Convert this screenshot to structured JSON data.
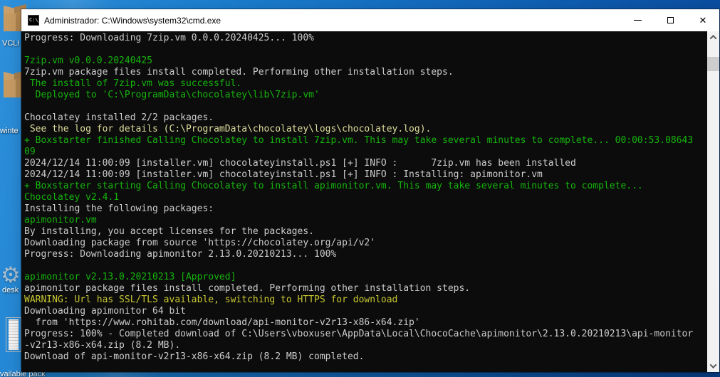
{
  "palette": {
    "consoleBg": "#0C0C0C",
    "white": "#CCCCCC",
    "green": "#15B50D",
    "yellow": "#C9C932",
    "paleYellow": "#DEDE9E",
    "titlebarBg": "#FFFFFF",
    "desktopBlue": "#1671C4"
  },
  "desktop": {
    "icons": [
      {
        "label": "VCLi",
        "type": "box"
      },
      {
        "label": "winte",
        "type": "box"
      },
      {
        "label": "desk",
        "type": "gear",
        "glyph": "⚙"
      },
      {
        "label": "vailable pack",
        "type": "note"
      }
    ]
  },
  "window": {
    "title": "Administrador: C:\\Windows\\system32\\cmd.exe",
    "icon_glyph": "C:\\_",
    "controls": {
      "close_glyph": "✕"
    }
  },
  "console": {
    "lines": [
      {
        "text": "Progress: Downloading 7zip.vm 0.0.0.20240425... 100%",
        "color": "white"
      },
      {
        "text": "",
        "color": "white"
      },
      {
        "text": "7zip.vm v0.0.0.20240425",
        "color": "green"
      },
      {
        "text": "7zip.vm package files install completed. Performing other installation steps.",
        "color": "white"
      },
      {
        "text": " The install of 7zip.vm was successful.",
        "color": "green"
      },
      {
        "text": "  Deployed to 'C:\\ProgramData\\chocolatey\\lib\\7zip.vm'",
        "color": "green"
      },
      {
        "text": "",
        "color": "white"
      },
      {
        "text": "Chocolatey installed 2/2 packages.",
        "color": "white"
      },
      {
        "text": " See the log for details (C:\\ProgramData\\chocolatey\\logs\\chocolatey.log).",
        "color": "paleyellow"
      },
      {
        "text": "+ Boxstarter finished Calling Chocolatey to install 7zip.vm. This may take several minutes to complete... 00:00:53.08643",
        "color": "green"
      },
      {
        "text": "09",
        "color": "green"
      },
      {
        "text": "2024/12/14 11:00:09 [installer.vm] chocolateyinstall.ps1 [+] INFO :      7zip.vm has been installed",
        "color": "white"
      },
      {
        "text": "2024/12/14 11:00:09 [installer.vm] chocolateyinstall.ps1 [+] INFO : Installing: apimonitor.vm",
        "color": "white"
      },
      {
        "text": "+ Boxstarter starting Calling Chocolatey to install apimonitor.vm. This may take several minutes to complete...",
        "color": "green"
      },
      {
        "text": "Chocolatey v2.4.1",
        "color": "green"
      },
      {
        "text": "Installing the following packages:",
        "color": "white"
      },
      {
        "text": "apimonitor.vm",
        "color": "green"
      },
      {
        "text": "By installing, you accept licenses for the packages.",
        "color": "white"
      },
      {
        "text": "Downloading package from source 'https://chocolatey.org/api/v2'",
        "color": "white"
      },
      {
        "text": "Progress: Downloading apimonitor 2.13.0.20210213... 100%",
        "color": "white"
      },
      {
        "text": "",
        "color": "white"
      },
      {
        "text": "apimonitor v2.13.0.20210213 [Approved]",
        "color": "green"
      },
      {
        "text": "apimonitor package files install completed. Performing other installation steps.",
        "color": "white"
      },
      {
        "text": "WARNING: Url has SSL/TLS available, switching to HTTPS for download",
        "color": "yellow"
      },
      {
        "text": "Downloading apimonitor 64 bit",
        "color": "white"
      },
      {
        "text": "  from 'https://www.rohitab.com/download/api-monitor-v2r13-x86-x64.zip'",
        "color": "white"
      },
      {
        "text": "Progress: 100% - Completed download of C:\\Users\\vboxuser\\AppData\\Local\\ChocoCache\\apimonitor\\2.13.0.20210213\\api-monitor",
        "color": "white"
      },
      {
        "text": "-v2r13-x86-x64.zip (8.2 MB).",
        "color": "white"
      },
      {
        "text": "Download of api-monitor-v2r13-x86-x64.zip (8.2 MB) completed.",
        "color": "white"
      }
    ]
  }
}
